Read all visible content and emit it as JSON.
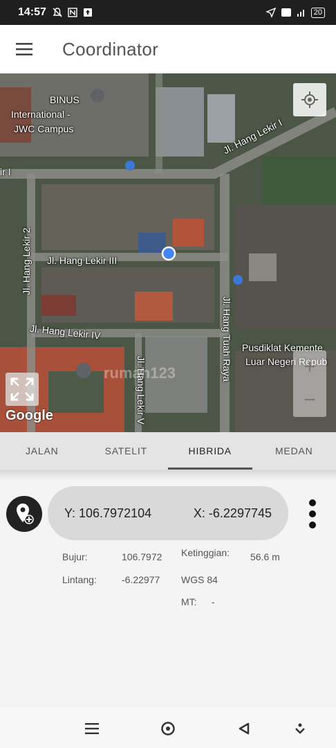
{
  "status_bar": {
    "time": "14:57",
    "battery": "20",
    "icons_left": [
      "notifications-off-icon",
      "nfc-icon",
      "upload-icon"
    ],
    "icons_right": [
      "location-arrow-icon",
      "volte-icon",
      "signal-4g-icon",
      "battery-icon"
    ]
  },
  "app_bar": {
    "title": "Coordinator",
    "menu_icon": "hamburger-menu-icon"
  },
  "map": {
    "labels": {
      "binus_line1": "BINUS",
      "binus_line2": "International -",
      "binus_line3": "JWC Campus",
      "hang_lekir_i": "Jl. Hang Lekir I",
      "hang_lekir_i_left": "ir I",
      "hang_lekir_2": "Jl. Hang Lekir 2",
      "hang_lekir_iii": "Jl. Hang Lekir III",
      "hang_lekir_iv": "Jl. Hang Lekir IV",
      "hang_lekir_v": "Jl. Hang Lekir V",
      "hang_tuah_raya": "Jl. Hang Tuah Raya",
      "pusdiklat_line1": "Pusdiklat Kemente",
      "pusdiklat_line2": "Luar Negeri Repub",
      "left_edge_v": "Jl. H"
    },
    "watermark": "rumah123",
    "google_logo": "Google",
    "zoom_in": "+",
    "zoom_out": "−"
  },
  "tabs": [
    {
      "label": "JALAN",
      "active": false
    },
    {
      "label": "SATELIT",
      "active": false
    },
    {
      "label": "HIBRIDA",
      "active": true
    },
    {
      "label": "MEDAN",
      "active": false
    }
  ],
  "coordinates": {
    "y_text": "Y: 106.7972104",
    "x_text": "X: -6.2297745"
  },
  "details": {
    "bujur_label": "Bujur:",
    "bujur_value": "106.7972",
    "lintang_label": "Lintang:",
    "lintang_value": "-6.22977",
    "ketinggian_label": "Ketinggian:",
    "ketinggian_value": "56.6 m",
    "datum": "WGS 84",
    "mt_label": "MT:",
    "mt_value": "-"
  },
  "colors": {
    "accent_dot": "#4285f4",
    "pill_bg": "#d9d9d9",
    "status_bar_bg": "#1f1f1f"
  }
}
